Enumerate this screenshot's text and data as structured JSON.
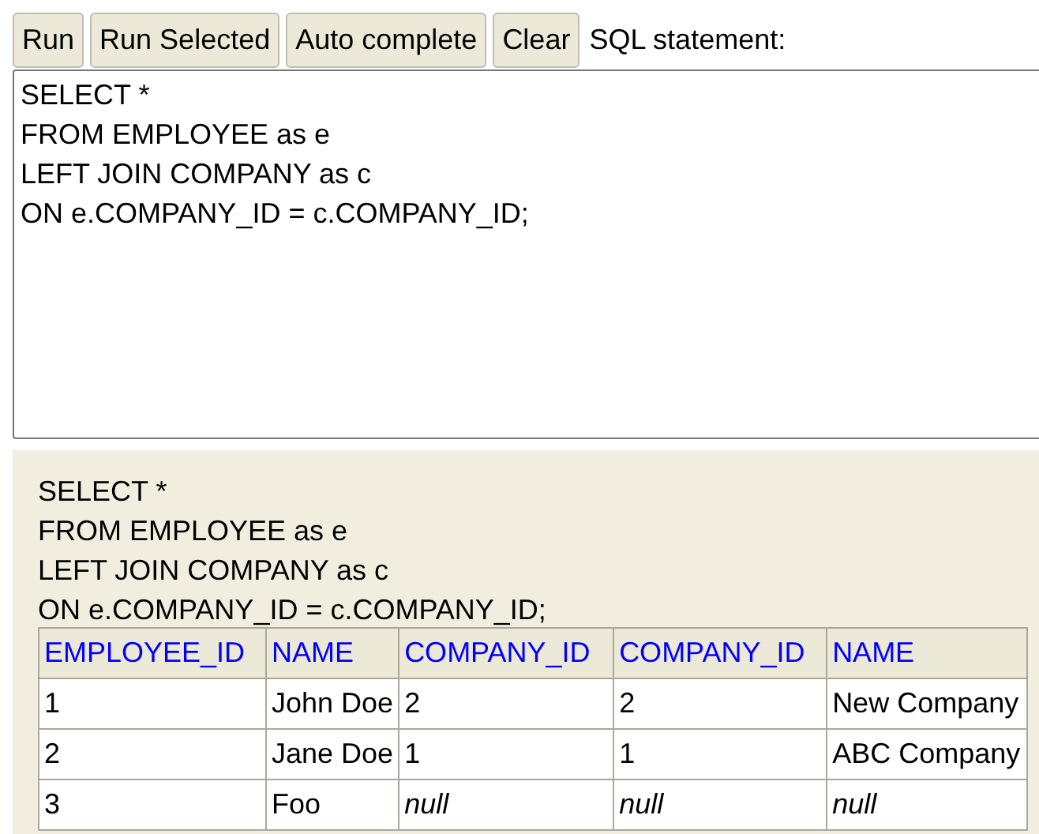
{
  "toolbar": {
    "buttons": [
      "Run",
      "Run Selected",
      "Auto complete",
      "Clear"
    ],
    "label": "SQL statement:"
  },
  "editor": {
    "value": "SELECT *\nFROM EMPLOYEE as e\nLEFT JOIN COMPANY as c\nON e.COMPANY_ID = c.COMPANY_ID;"
  },
  "result": {
    "statement": "SELECT *\nFROM EMPLOYEE as e\nLEFT JOIN COMPANY as c\nON e.COMPANY_ID = c.COMPANY_ID;",
    "table": {
      "columns": [
        "EMPLOYEE_ID",
        "NAME",
        "COMPANY_ID",
        "COMPANY_ID",
        "NAME"
      ],
      "rows": [
        [
          {
            "text": "1",
            "kind": "value"
          },
          {
            "text": "John Doe",
            "kind": "value"
          },
          {
            "text": "2",
            "kind": "value"
          },
          {
            "text": "2",
            "kind": "value"
          },
          {
            "text": "New Company",
            "kind": "value"
          }
        ],
        [
          {
            "text": "2",
            "kind": "value"
          },
          {
            "text": "Jane Doe",
            "kind": "value"
          },
          {
            "text": "1",
            "kind": "value"
          },
          {
            "text": "1",
            "kind": "value"
          },
          {
            "text": "ABC Company",
            "kind": "value"
          }
        ],
        [
          {
            "text": "3",
            "kind": "value"
          },
          {
            "text": "Foo",
            "kind": "value"
          },
          {
            "text": "null",
            "kind": "null"
          },
          {
            "text": "null",
            "kind": "null"
          },
          {
            "text": "null",
            "kind": "null"
          }
        ]
      ]
    }
  }
}
